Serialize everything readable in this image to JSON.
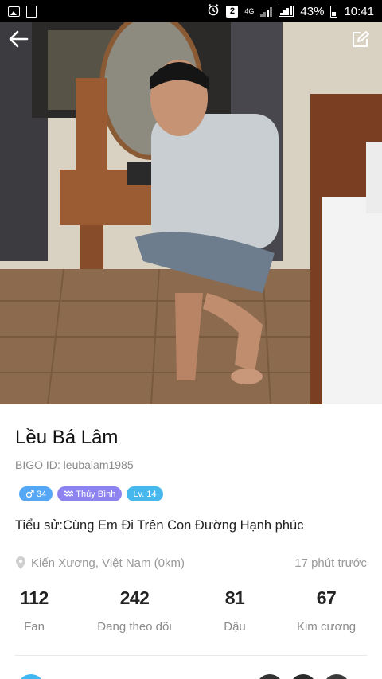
{
  "status_bar": {
    "battery": "43%",
    "time": "10:41",
    "badge": "2",
    "network": "4G"
  },
  "profile": {
    "name": "Lều Bá Lâm",
    "bigo_id": "BIGO ID: leubalam1985",
    "tags": {
      "gender_age": "34",
      "zodiac": "Thủy Bình",
      "level": "Lv. 14"
    },
    "bio": "Tiểu sử:Cùng Em Đi Trên Con Đường Hạnh phúc",
    "location": "Kiến Xương, Việt Nam (0km)",
    "last_seen": "17 phút trước"
  },
  "stats": [
    {
      "value": "112",
      "label": "Fan"
    },
    {
      "value": "242",
      "label": "Đang theo dõi"
    },
    {
      "value": "81",
      "label": "Đậu"
    },
    {
      "value": "67",
      "label": "Kim cương"
    }
  ],
  "colors": {
    "gender_tag": "#53a7f5",
    "zodiac_tag": "#8d83f0",
    "level_tag": "#47b8ee"
  }
}
